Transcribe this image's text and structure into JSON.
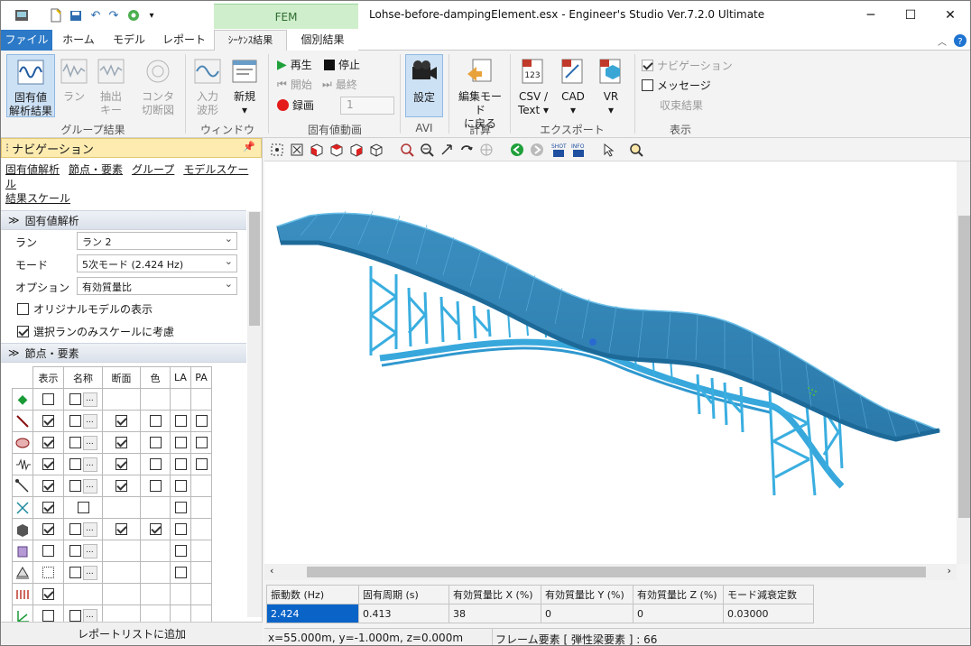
{
  "window": {
    "title": "Lohse-before-dampingElement.esx - Engineer's Studio Ver.7.2.0 Ultimate",
    "context_tab": "FEM"
  },
  "ribbon_tabs": [
    "ファイル",
    "ホーム",
    "モデル",
    "レポート",
    "ｼｰｹﾝｽ結果",
    "個別結果"
  ],
  "ribbon": {
    "group_results": {
      "label": "グループ結果",
      "buttons": [
        {
          "l1": "固有値",
          "l2": "解析結果"
        },
        {
          "l1": "ラン",
          "l2": ""
        },
        {
          "l1": "抽出",
          "l2": "キー"
        },
        {
          "l1": "コンタ",
          "l2": "切断図"
        }
      ]
    },
    "window": {
      "label": "ウィンドウ",
      "buttons": [
        {
          "l1": "入力",
          "l2": "波形"
        },
        {
          "l1": "新規",
          "l2": "▾"
        }
      ]
    },
    "eigen_anim": {
      "label": "固有値動画",
      "play": "再生",
      "stop": "停止",
      "start": "開始",
      "last": "最終",
      "record": "録画",
      "frame": "1"
    },
    "avi": {
      "label": "AVI",
      "button": "設定"
    },
    "calc": {
      "label": "計算",
      "l1": "編集モード",
      "l2": "に戻る"
    },
    "export": {
      "label": "エクスポート",
      "buttons": [
        {
          "l1": "CSV /",
          "l2": "Text ▾"
        },
        {
          "l1": "CAD",
          "l2": "▾"
        },
        {
          "l1": "VR",
          "l2": "▾"
        }
      ]
    },
    "display": {
      "label": "表示",
      "navigation": "ナビゲーション",
      "message": "メッセージ",
      "converge": "収束結果"
    }
  },
  "navigation": {
    "title": "ナビゲーション",
    "links": [
      "固有値解析",
      "節点・要素",
      "グループ",
      "モデルスケール",
      "結果スケール"
    ],
    "section1": "固有値解析",
    "run_label": "ラン",
    "run_value": "ラン 2",
    "mode_label": "モード",
    "mode_value": "5次モード (2.424 Hz)",
    "option_label": "オプション",
    "option_value": "有効質量比",
    "check_original": "オリジナルモデルの表示",
    "check_scale": "選択ランのみスケールに考慮",
    "section2": "節点・要素",
    "grid_headers": [
      "表示",
      "名称",
      "断面",
      "色",
      "LA",
      "PA"
    ],
    "report_button": "レポートリストに追加"
  },
  "results": {
    "headers": [
      "振動数 (Hz)",
      "固有周期 (s)",
      "有効質量比 X (%)",
      "有効質量比 Y (%)",
      "有効質量比 Z (%)",
      "モード減衰定数"
    ],
    "row": [
      "2.424",
      "0.413",
      "38",
      "0",
      "0",
      "0.03000"
    ]
  },
  "status": {
    "coords": "x=55.000m, y=-1.000m, z=0.000m",
    "element": "フレーム要素 [ 弾性梁要素 ] : 66"
  },
  "colors": {
    "accent": "#2b79c7",
    "bridge": "#3aa6d6",
    "nav_header": "#fdebb0",
    "fem_tab": "#cfeecb"
  }
}
